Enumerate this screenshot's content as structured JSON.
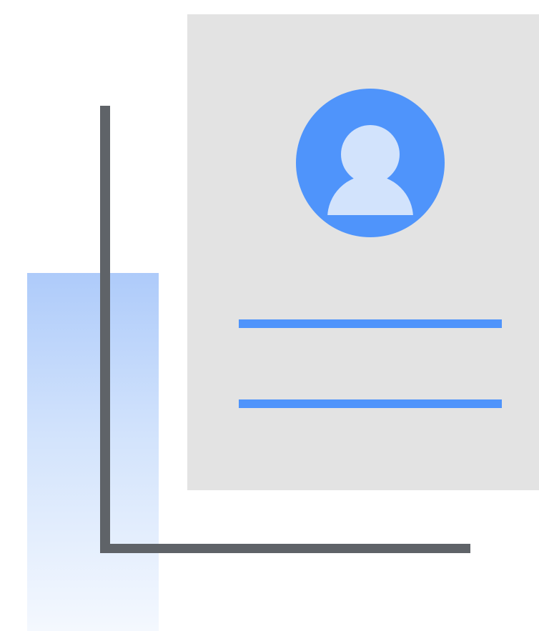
{
  "illustration": {
    "subject": "profile-card-icon",
    "colors": {
      "background": "#ffffff",
      "card": "#e3e3e3",
      "accent_blue": "#4f94fb",
      "light_blue": "#d2e3fc",
      "gradient_top": "#aecbfa",
      "gradient_bottom": "#f4f8fe",
      "axis": "#5f6368"
    },
    "icons": [
      "avatar-icon",
      "person-icon"
    ]
  }
}
